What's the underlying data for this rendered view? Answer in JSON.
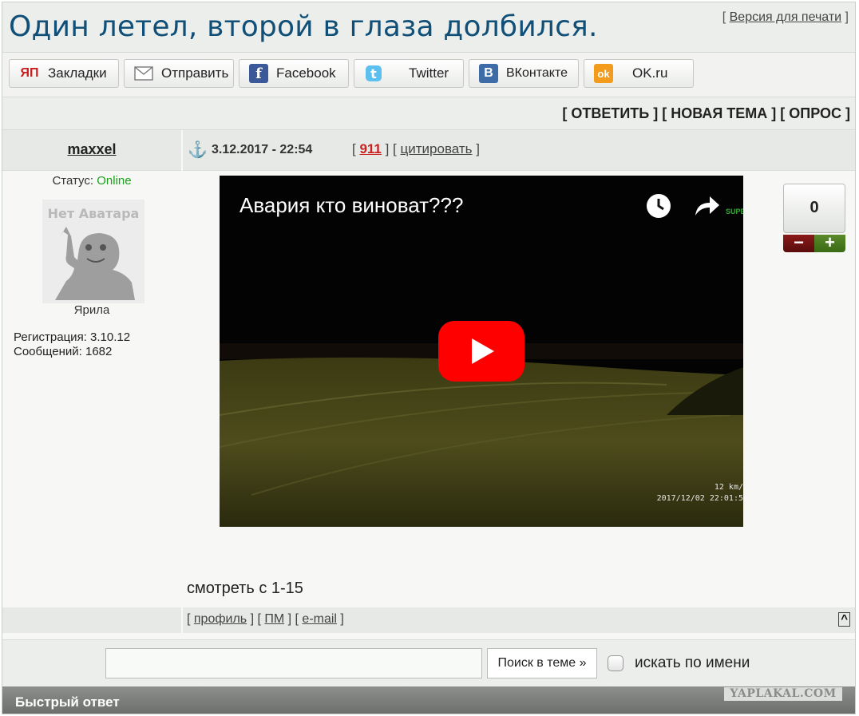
{
  "page": {
    "title": "Один летел, второй в глаза долбился.",
    "print_link": "Версия для печати"
  },
  "share": [
    {
      "label": "Закладки",
      "icon": "yap-bookmarks-icon",
      "glyph": "ЯП"
    },
    {
      "label": "Отправить",
      "icon": "mail-icon",
      "glyph": ""
    },
    {
      "label": "Facebook",
      "icon": "facebook-icon",
      "glyph": "f"
    },
    {
      "label": "Twitter",
      "icon": "twitter-icon",
      "glyph": ""
    },
    {
      "label": "ВКонтакте",
      "icon": "vkontakte-icon",
      "glyph": "В"
    },
    {
      "label": "OK.ru",
      "icon": "odnoklassniki-icon",
      "glyph": "ok"
    }
  ],
  "actions": {
    "reply": "[ ОТВЕТИТЬ ]",
    "new_topic": "[ НОВАЯ ТЕМА ]",
    "poll": "[ ОПРОС ]"
  },
  "post": {
    "author": "maxxel",
    "date": "3.12.2017 - 22:54",
    "report_count": "911",
    "quote": "цитировать",
    "text": "смотреть с 1-15",
    "rating": "0",
    "vote_minus": "−",
    "vote_plus": "+"
  },
  "user": {
    "status_label": "Статус:",
    "status_value": "Online",
    "avatar_text": "Нет Аватара",
    "name": "Ярила",
    "registration": "Регистрация: 3.10.12",
    "messages": "Сообщений: 1682"
  },
  "video": {
    "title": "Авария кто виноват???",
    "sup_text": "SUPE",
    "stamp_speed": "12 km/",
    "stamp_time": "2017/12/02 22:01:5"
  },
  "footer_links": {
    "profile": "профиль",
    "pm": "ПМ",
    "email": "e-mail",
    "totop": "^"
  },
  "search": {
    "button": "Поиск в теме »",
    "by_name": "искать по имени"
  },
  "quick_reply": {
    "label": "Быстрый ответ",
    "logo": "YAPLAKAL.COM"
  },
  "colors": {
    "title": "#0f4f78",
    "online": "#1aa01a",
    "report": "#cc1f1f",
    "youtube_red": "#ff0000"
  }
}
